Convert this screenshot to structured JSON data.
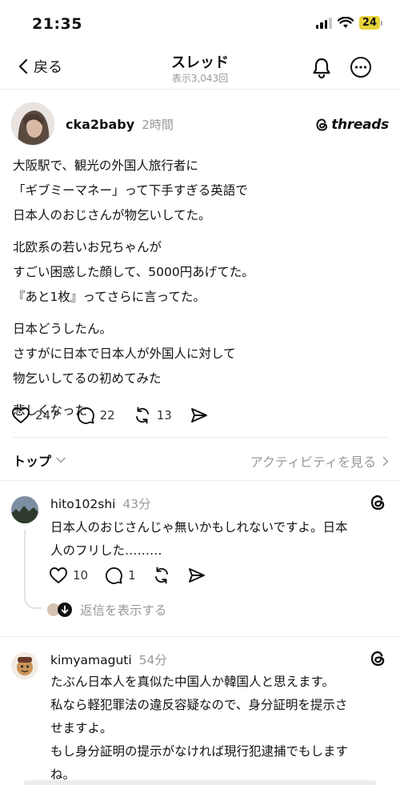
{
  "status_bar": {
    "time": "21:35",
    "battery": "24"
  },
  "nav": {
    "back_label": "戻る",
    "title": "スレッド",
    "subtitle": "表示3,043回",
    "icons": [
      "chevron-left-icon",
      "bell-icon",
      "more-icon"
    ]
  },
  "post": {
    "username": "cka2baby",
    "time": "2時間",
    "brand": "threads",
    "paragraphs": [
      [
        "大阪駅で、観光の外国人旅行者に",
        "「ギブミーマネー」って下手すぎる英語で",
        "日本人のおじさんが物乞いしてた。"
      ],
      [
        "北欧系の若いお兄ちゃんが",
        "すごい困惑した顔して、5000円あげてた。",
        "『あと1枚』ってさらに言ってた。"
      ],
      [
        "日本どうしたん。",
        "さすがに日本で日本人が外国人に対して",
        "物乞いしてるの初めてみた"
      ],
      [
        "悲しくなった"
      ]
    ],
    "likes": "247",
    "comments": "22",
    "reposts": "13"
  },
  "sort": {
    "top_label": "トップ",
    "activity_label": "アクティビティを見る"
  },
  "replies": [
    {
      "username": "hito102shi",
      "time": "43分",
      "lines": [
        "日本人のおじさんじゃ無いかもしれないですよ。日本",
        "人のフリした………"
      ],
      "likes": "10",
      "comments": "1",
      "show_replies": "返信を表示する"
    },
    {
      "username": "kimyamaguti",
      "time": "54分",
      "lines": [
        "たぶん日本人を真似た中国人か韓国人と思えます。",
        "私なら軽犯罪法の違反容疑なので、身分証明を提示さ",
        "せますよ。",
        "もし身分証明の提示がなければ現行犯逮捕でもします",
        "ね。"
      ]
    }
  ],
  "colors": {
    "text": "#111111",
    "muted": "#999999",
    "divider": "#ebebeb",
    "battery": "#e8d33a"
  }
}
